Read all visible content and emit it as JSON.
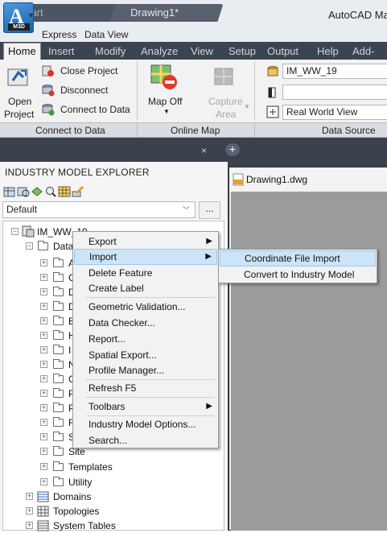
{
  "app": {
    "title": "AutoCAD Map",
    "logo_letter": "A",
    "logo_badge": "M3D"
  },
  "menubar": {
    "items": [
      "Express",
      "Data View"
    ]
  },
  "ribbon_tabs": [
    "Home",
    "Insert",
    "Modify",
    "Analyze",
    "View",
    "Setup",
    "Output",
    "Help",
    "Add-ins"
  ],
  "ribbon": {
    "open_project": {
      "line1": "Open",
      "line2": "Project"
    },
    "close_project": "Close Project",
    "disconnect": "Disconnect",
    "connect_to_data": "Connect to Data",
    "map_off": "Map Off",
    "capture_area": {
      "line1": "Capture",
      "line2": "Area"
    },
    "datasource_combo": "IM_WW_19",
    "view_combo": "Real World View",
    "panels": [
      "Connect to Data",
      "Online Map",
      "Data Source"
    ]
  },
  "file_tabs": {
    "start": "Start",
    "drawing": "Drawing1*",
    "close": "×",
    "add": "+"
  },
  "explorer": {
    "title": "INDUSTRY MODEL EXPLORER",
    "select_value": "Default",
    "more_button": "...",
    "tree": {
      "root": "IM_WW_19",
      "data": "Data",
      "leaf_letters": [
        "A",
        "C",
        "D",
        "D",
        "E",
        "H",
        "I",
        "N",
        "C",
        "P",
        "P",
        "F",
        "S"
      ],
      "site": "Site",
      "templates": "Templates",
      "utility": "Utility",
      "domains": "Domains",
      "topologies": "Topologies",
      "system_tables": "System Tables"
    }
  },
  "drawing": {
    "title": "Drawing1.dwg"
  },
  "context_menu": {
    "items": [
      {
        "label": "Export",
        "submenu": true
      },
      {
        "label": "Import",
        "submenu": true,
        "highlighted": true
      },
      {
        "label": "Delete Feature"
      },
      {
        "label": "Create Label"
      },
      {
        "label": "Geometric Validation..."
      },
      {
        "label": "Data Checker..."
      },
      {
        "label": "Report..."
      },
      {
        "label": "Spatial Export..."
      },
      {
        "label": "Profile Manager..."
      },
      {
        "label": "Refresh F5"
      },
      {
        "label": "Toolbars",
        "submenu": true
      },
      {
        "label": "Industry Model Options..."
      },
      {
        "label": "Search..."
      }
    ]
  },
  "submenu": {
    "items": [
      {
        "label": "Coordinate File Import",
        "highlighted": true
      },
      {
        "label": "Convert to Industry Model"
      }
    ]
  }
}
